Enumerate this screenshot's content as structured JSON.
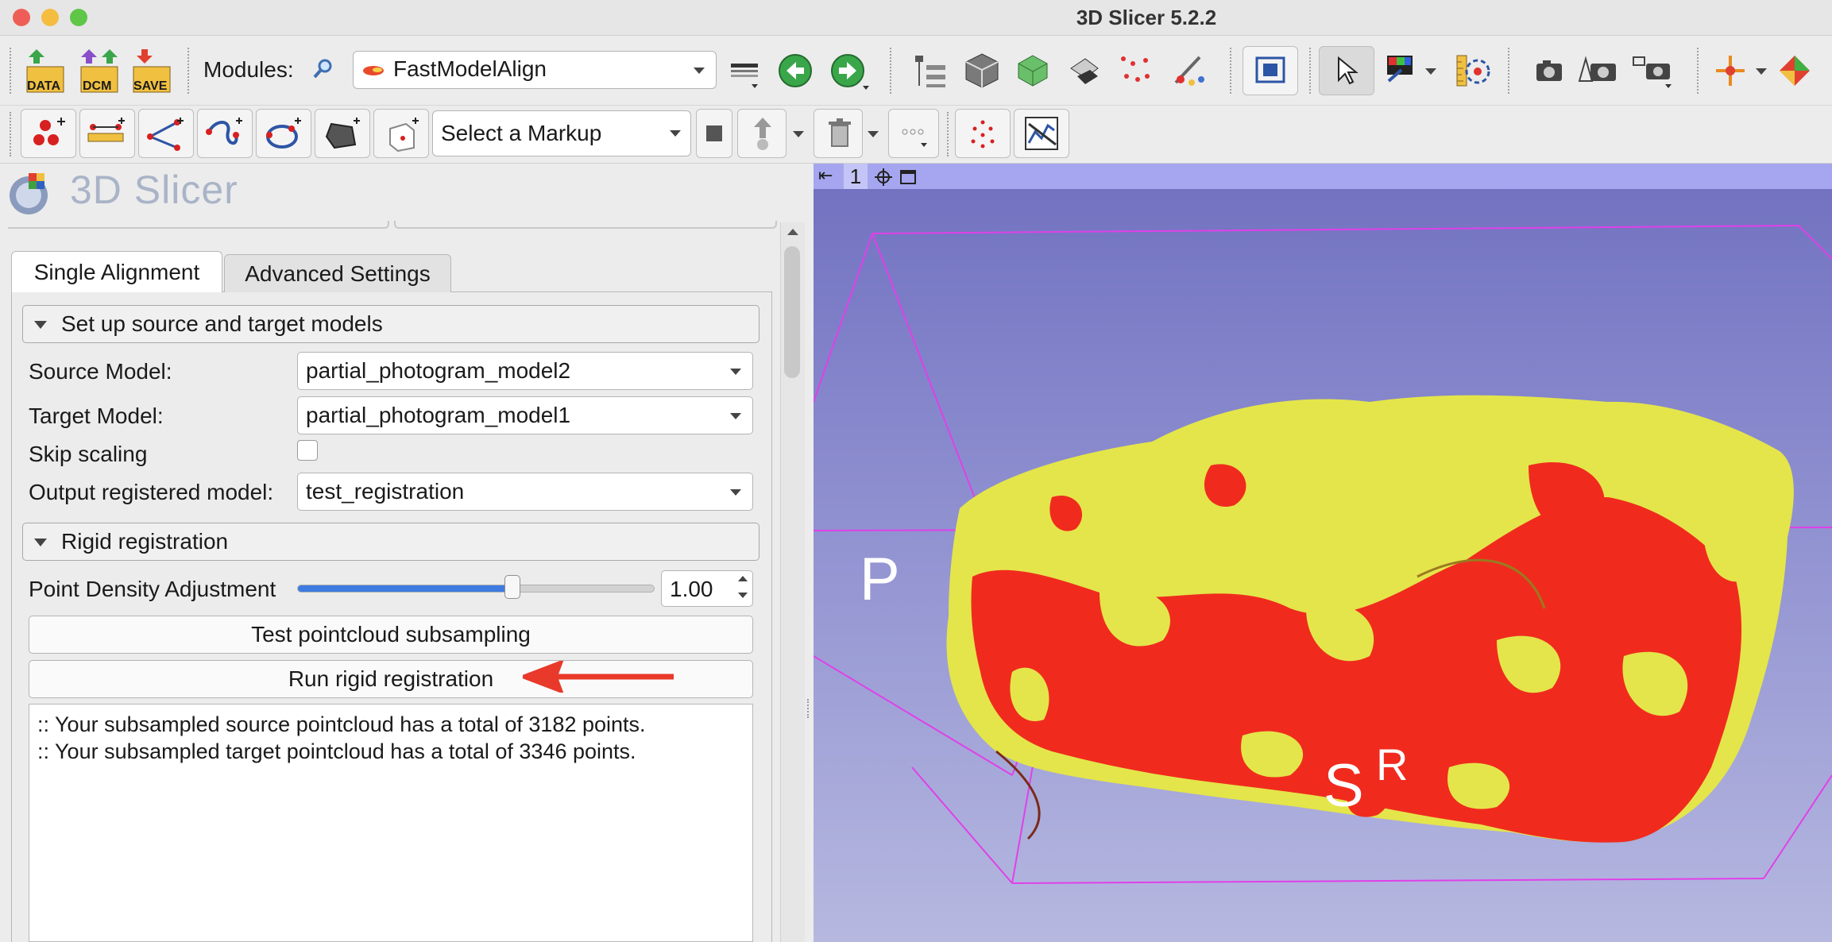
{
  "window": {
    "title": "3D Slicer 5.2.2"
  },
  "toolbar": {
    "data_label": "DATA",
    "dcm_label": "DCM",
    "save_label": "SAVE",
    "modules_label": "Modules:",
    "module_selected": "FastModelAlign",
    "markup_select_value": "Select a Markup"
  },
  "panel": {
    "logo_text": "3D Slicer",
    "tabs": [
      {
        "label": "Single Alignment",
        "active": true
      },
      {
        "label": "Advanced Settings",
        "active": false
      }
    ],
    "section_models": "Set up source and target models",
    "source_label": "Source Model:",
    "source_value": "partial_photogram_model2",
    "target_label": "Target Model:",
    "target_value": "partial_photogram_model1",
    "skip_label": "Skip scaling",
    "skip_checked": false,
    "output_label": "Output registered model:",
    "output_value": "test_registration",
    "section_rigid": "Rigid registration",
    "density_label": "Point Density Adjustment",
    "density_value": "1.00",
    "density_fraction": 0.6,
    "test_button": "Test pointcloud subsampling",
    "run_button": "Run rigid registration",
    "log_lines": [
      ":: Your subsampled source pointcloud has a total of 3182 points.",
      ":: Your subsampled target pointcloud has a total of 3346 points."
    ]
  },
  "view": {
    "view_number": "1",
    "orient_p": "P",
    "orient_s": "S",
    "orient_r": "R",
    "model_color_source": "#f02b1e",
    "model_color_target": "#e4e54a",
    "box_color": "#e040e8"
  },
  "colors": {
    "annotation_arrow": "#e8392a"
  }
}
